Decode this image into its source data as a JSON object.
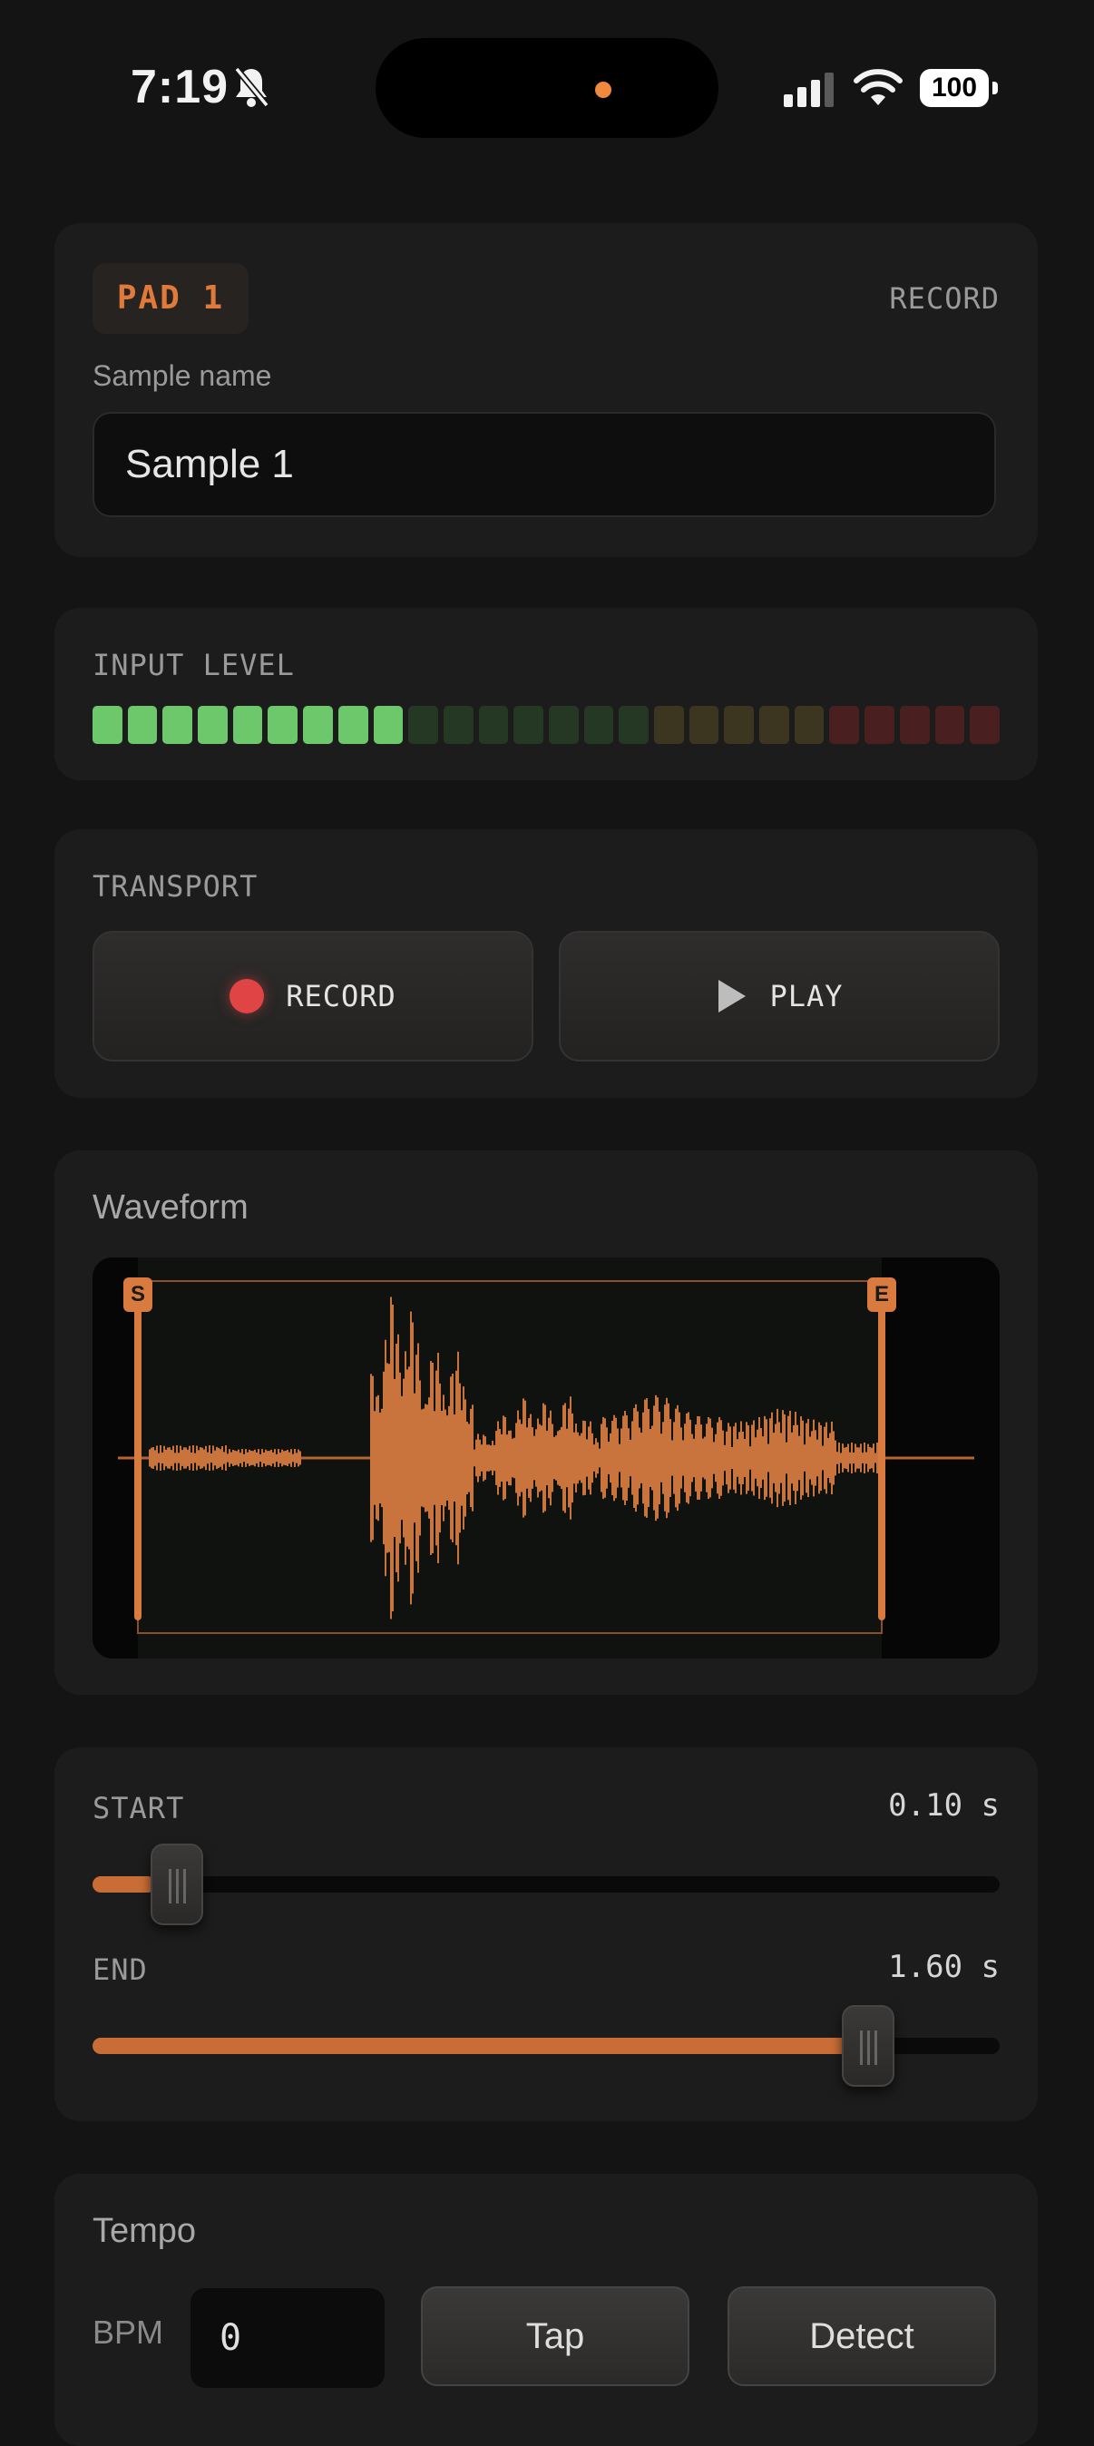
{
  "status_bar": {
    "time": "7:19",
    "battery": "100",
    "icons": [
      "bell-slash-icon",
      "signal-icon",
      "wifi-icon",
      "battery-icon"
    ]
  },
  "pad": {
    "badge": "PAD 1",
    "mode": "RECORD",
    "sample_label": "Sample name",
    "sample_value": "Sample 1"
  },
  "input_level": {
    "label": "INPUT LEVEL",
    "lit_segments": 9,
    "total_segments": 26,
    "colors": {
      "green_on": "#6cc86a",
      "green_off": "#243824",
      "yellow_off": "#3c3520",
      "red_off": "#4a1f1f"
    }
  },
  "transport": {
    "label": "TRANSPORT",
    "record_label": "RECORD",
    "play_label": "PLAY"
  },
  "waveform": {
    "title": "Waveform",
    "start_tag": "S",
    "end_tag": "E",
    "accent": "#d97a3f"
  },
  "trim": {
    "start": {
      "label": "START",
      "value": "0.10 s",
      "level": 0.07
    },
    "end": {
      "label": "END",
      "value": "1.60 s",
      "level": 0.85
    }
  },
  "tempo": {
    "title": "Tempo",
    "bpm_label": "BPM",
    "bpm_value": "0",
    "tap_label": "Tap",
    "detect_label": "Detect"
  }
}
